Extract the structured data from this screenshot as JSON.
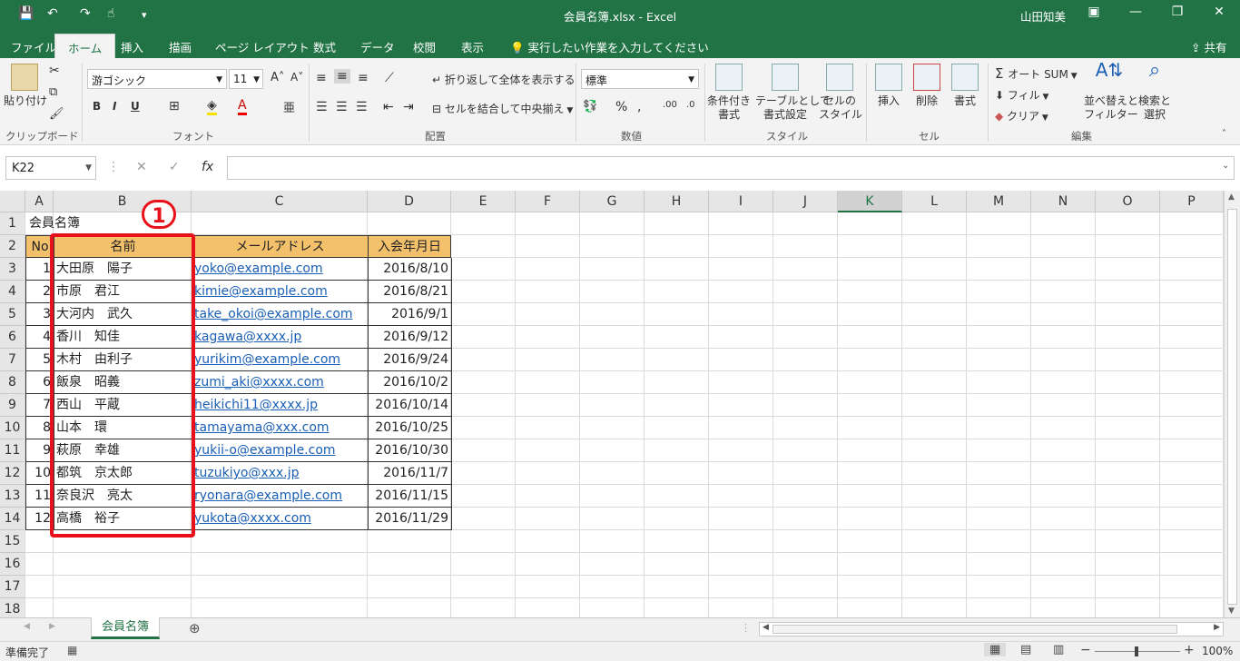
{
  "titlebar": {
    "title": "会員名簿.xlsx  -  Excel",
    "user": "山田知美",
    "undo": "↶",
    "redo": "↷",
    "save_icon": "save-icon"
  },
  "tabs": [
    "ファイル",
    "ホーム",
    "挿入",
    "描画",
    "ページ レイアウト",
    "数式",
    "データ",
    "校閲",
    "表示"
  ],
  "tellme": "実行したい作業を入力してください",
  "share": "共有",
  "ribbon": {
    "paste": "貼り付け",
    "clipboard": "クリップボード",
    "font_name": "游ゴシック",
    "font_size": "11",
    "font_group": "フォント",
    "wrap": "折り返して全体を表示する",
    "merge": "セルを結合して中央揃え",
    "align_group": "配置",
    "number_format": "標準",
    "number_group": "数値",
    "cond_format": [
      "条件付き",
      "書式"
    ],
    "table_format": [
      "テーブルとして",
      "書式設定"
    ],
    "cell_style": [
      "セルの",
      "スタイル"
    ],
    "style_group": "スタイル",
    "insert": "挿入",
    "delete": "削除",
    "format": "書式",
    "cells_group": "セル",
    "autosum": "オート SUM",
    "fill": "フィル",
    "clear": "クリア",
    "sort": [
      "並べ替えと",
      "フィルター"
    ],
    "find": [
      "検索と",
      "選択"
    ],
    "edit_group": "編集",
    "bold": "B",
    "italic": "I",
    "underline": "U"
  },
  "formula_bar": {
    "name_box": "K22",
    "fx": "fx",
    "value": ""
  },
  "columns": [
    "A",
    "B",
    "C",
    "D",
    "E",
    "F",
    "G",
    "H",
    "I",
    "J",
    "K",
    "L",
    "M",
    "N",
    "O",
    "P"
  ],
  "rows": [
    "1",
    "2",
    "3",
    "4",
    "5",
    "6",
    "7",
    "8",
    "9",
    "10",
    "11",
    "12",
    "13",
    "14",
    "15",
    "16",
    "17",
    "18"
  ],
  "sheet": {
    "title": "会員名簿",
    "headers": {
      "no": "No",
      "name": "名前",
      "email": "メールアドレス",
      "date": "入会年月日"
    },
    "records": [
      {
        "no": "1",
        "name": "大田原　陽子",
        "email": "yoko@example.com",
        "date": "2016/8/10"
      },
      {
        "no": "2",
        "name": "市原　君江",
        "email": "kimie@example.com",
        "date": "2016/8/21"
      },
      {
        "no": "3",
        "name": "大河内　武久",
        "email": "take_okoi@example.com",
        "date": "2016/9/1"
      },
      {
        "no": "4",
        "name": "香川　知佳",
        "email": "kagawa@xxxx.jp",
        "date": "2016/9/12"
      },
      {
        "no": "5",
        "name": "木村　由利子",
        "email": "yurikim@example.com",
        "date": "2016/9/24"
      },
      {
        "no": "6",
        "name": "飯泉　昭義",
        "email": "zumi_aki@xxxx.com",
        "date": "2016/10/2"
      },
      {
        "no": "7",
        "name": "西山　平蔵",
        "email": "heikichi11@xxxx.jp",
        "date": "2016/10/14"
      },
      {
        "no": "8",
        "name": "山本　環",
        "email": "tamayama@xxx.com",
        "date": "2016/10/25"
      },
      {
        "no": "9",
        "name": "萩原　幸雄",
        "email": "yukii-o@example.com",
        "date": "2016/10/30"
      },
      {
        "no": "10",
        "name": "都筑　京太郎",
        "email": "tuzukiyo@xxx.jp",
        "date": "2016/11/7"
      },
      {
        "no": "11",
        "name": "奈良沢　亮太",
        "email": "ryonara@example.com",
        "date": "2016/11/15"
      },
      {
        "no": "12",
        "name": "高橋　裕子",
        "email": "yukota@xxxx.com",
        "date": "2016/11/29"
      }
    ]
  },
  "annotation": {
    "badge": "1"
  },
  "sheet_tab": "会員名簿",
  "status": {
    "ready": "準備完了",
    "zoom": "100%"
  }
}
